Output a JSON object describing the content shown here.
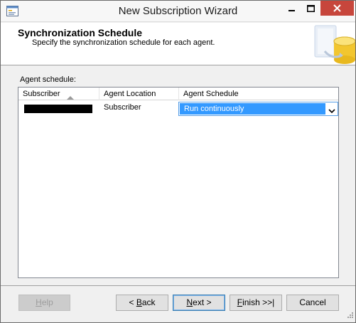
{
  "window": {
    "title": "New Subscription Wizard"
  },
  "header": {
    "title": "Synchronization Schedule",
    "subtitle": "Specify the synchronization schedule for each agent."
  },
  "agent_schedule": {
    "label": "Agent schedule:",
    "columns": [
      "Subscriber",
      "Agent Location",
      "Agent Schedule"
    ],
    "sort_column": "Subscriber",
    "sort_direction": "ascending",
    "rows": [
      {
        "subscriber": "",
        "subscriber_redacted": true,
        "agent_location": "Subscriber",
        "agent_schedule": "Run continuously"
      }
    ]
  },
  "buttons": {
    "help": {
      "pre": "",
      "key": "H",
      "post": "elp",
      "enabled": false
    },
    "back": {
      "pre": "< ",
      "key": "B",
      "post": "ack",
      "enabled": true
    },
    "next": {
      "pre": "",
      "key": "N",
      "post": "ext >",
      "enabled": true
    },
    "finish": {
      "pre": "",
      "key": "F",
      "post": "inish >>|",
      "enabled": true
    },
    "cancel": {
      "pre": "",
      "key": "",
      "post": "Cancel",
      "enabled": true
    }
  },
  "icons": {
    "app": "wizard-window-icon",
    "minimize": "minimize-icon",
    "maximize": "maximize-icon",
    "close": "close-icon",
    "header_graphic": "database-sync-icon",
    "sort": "sort-ascending-icon",
    "dropdown": "chevron-down-icon"
  },
  "colors": {
    "close_button": "#c7463c",
    "selection": "#3399ff",
    "focus_border": "#569de5"
  }
}
